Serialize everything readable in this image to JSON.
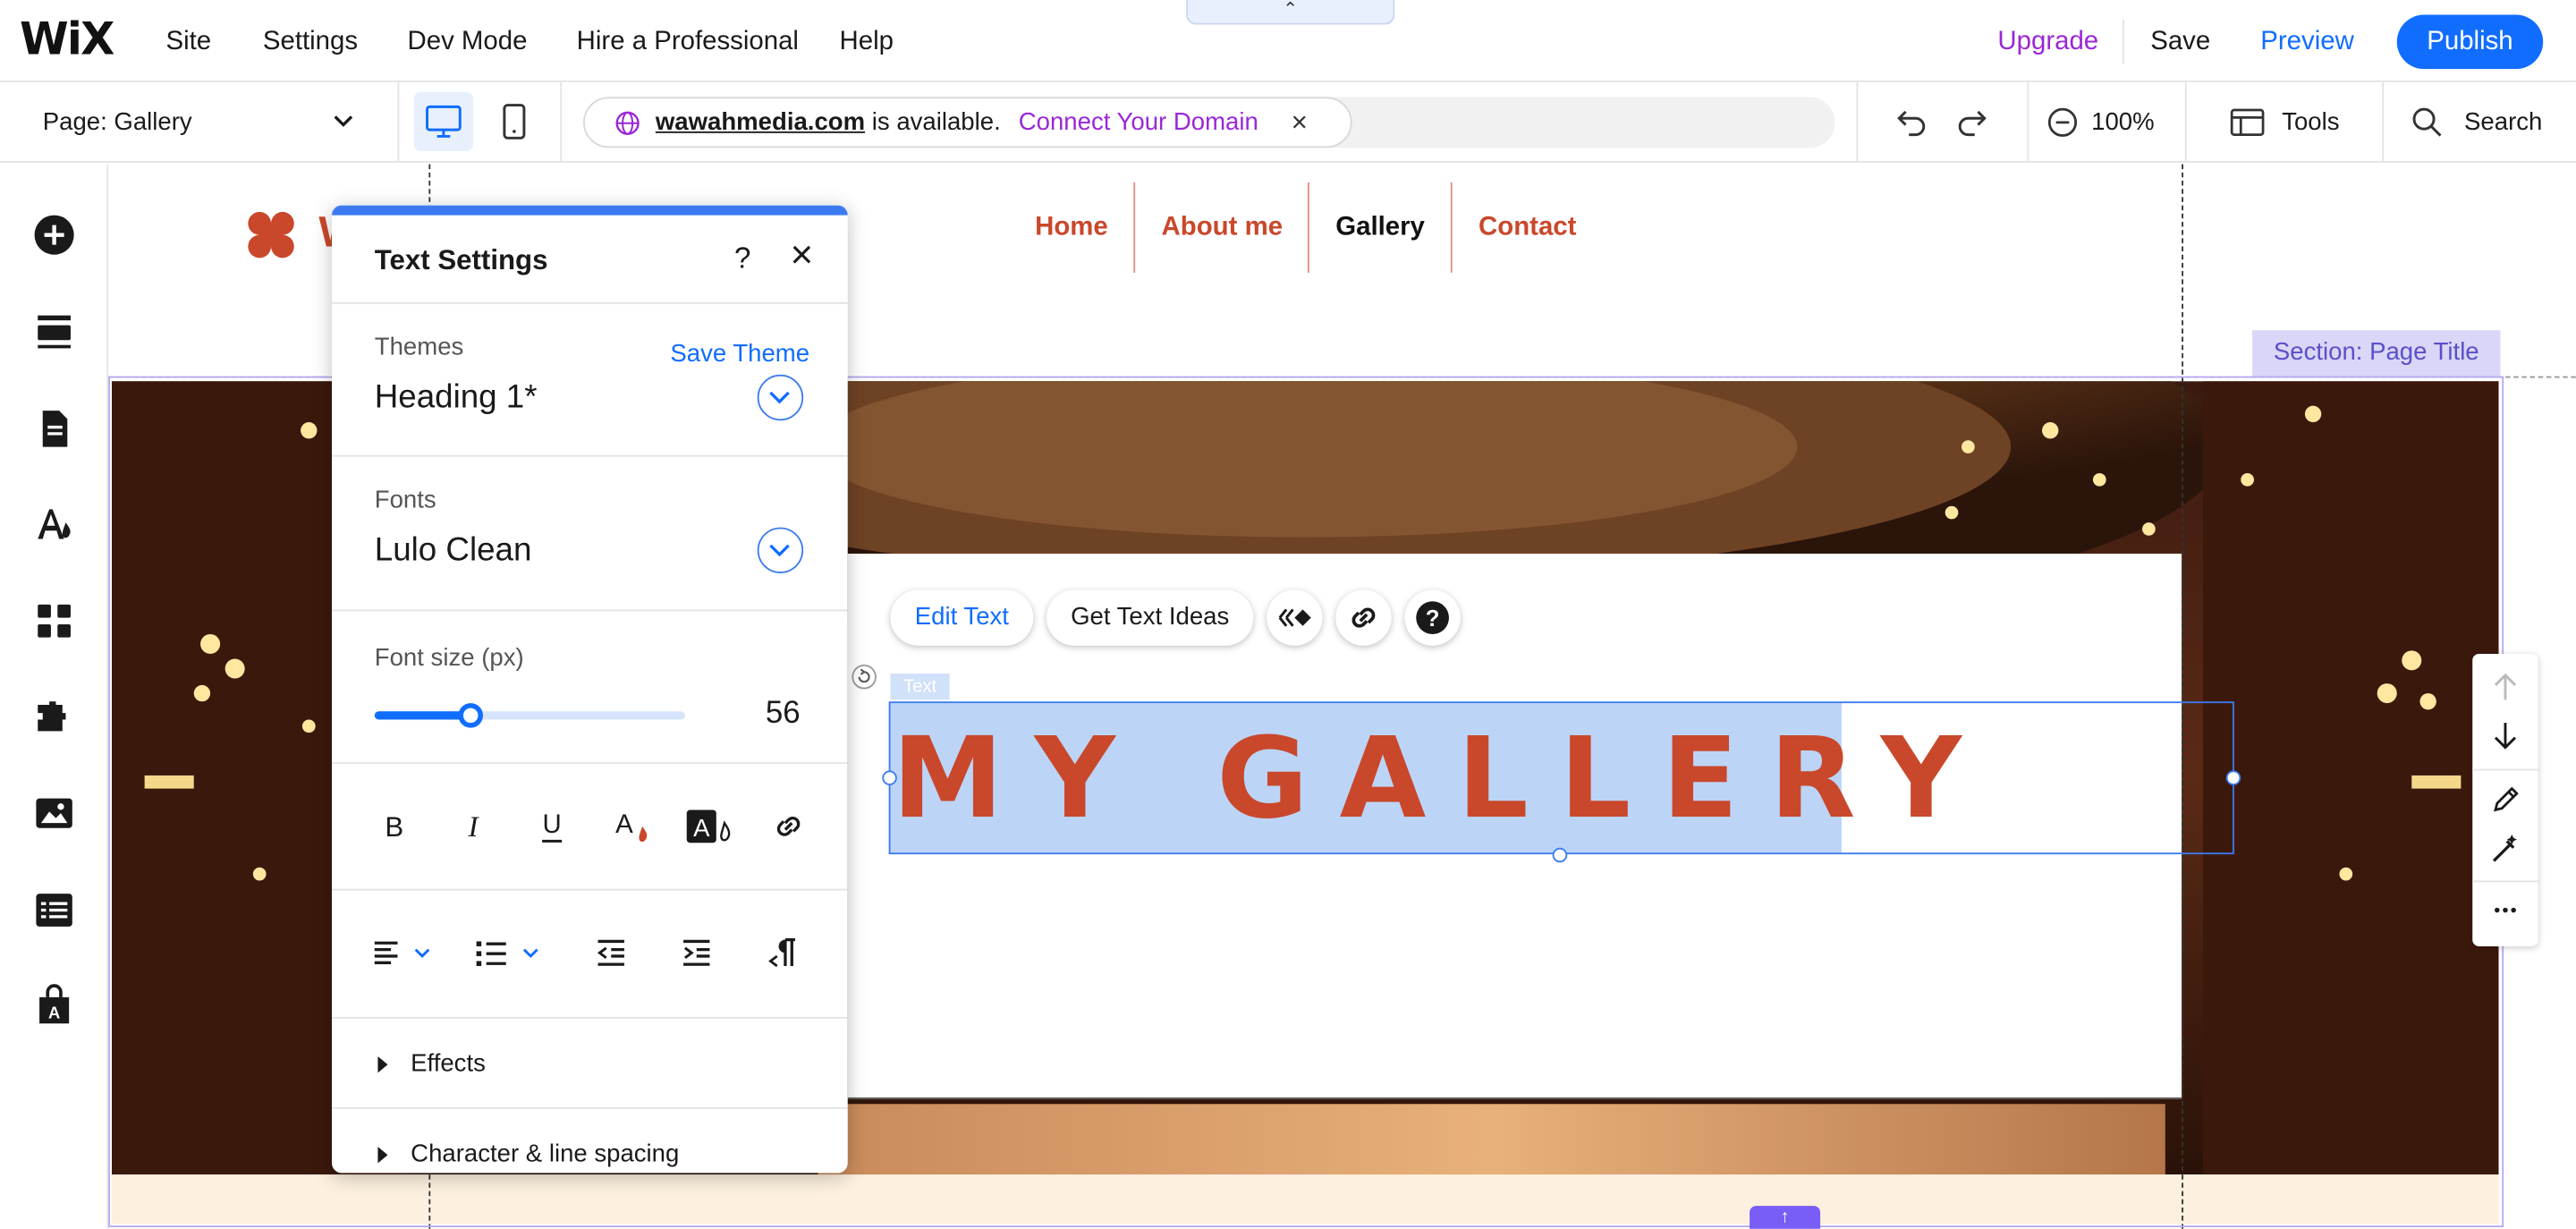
{
  "topbar": {
    "logo": "WiX",
    "menu": [
      "Site",
      "Settings",
      "Dev Mode",
      "Hire a Professional",
      "Help"
    ],
    "collapse_glyph": "⌃",
    "upgrade": "Upgrade",
    "save": "Save",
    "preview": "Preview",
    "publish": "Publish"
  },
  "secondbar": {
    "page_prefix": "Page: ",
    "page_name": "Gallery",
    "domain_name": "wawahmedia.com",
    "domain_suffix": " is available.",
    "connect_domain": "Connect Your Domain",
    "close_glyph": "×",
    "zoom": "100%",
    "tools": "Tools",
    "search": "Search"
  },
  "site": {
    "nav": [
      "Home",
      "About me",
      "Gallery",
      "Contact"
    ],
    "active_nav": "Gallery",
    "logo_partial": "W",
    "section_label": "Section: Page Title",
    "heading": "MY GALLERY",
    "text_tag": "Text",
    "bottom_handle_glyph": "↑"
  },
  "floating_toolbar": {
    "edit_text": "Edit Text",
    "get_text_ideas": "Get Text Ideas"
  },
  "text_settings": {
    "title": "Text Settings",
    "help_glyph": "?",
    "close_glyph": "×",
    "themes_label": "Themes",
    "save_theme": "Save Theme",
    "theme_value": "Heading 1*",
    "fonts_label": "Fonts",
    "font_value": "Lulo Clean",
    "font_size_label": "Font size (px)",
    "font_size_value": "56",
    "font_size_slider_fraction": 0.31,
    "effects": "Effects",
    "char_spacing": "Character & line spacing"
  },
  "colors": {
    "accent_blue": "#116dff",
    "upgrade_purple": "#9a27d5",
    "site_orange": "#c9482b",
    "selection_fill": "#bcd5f7",
    "section_purple": "#5b4fc9"
  }
}
